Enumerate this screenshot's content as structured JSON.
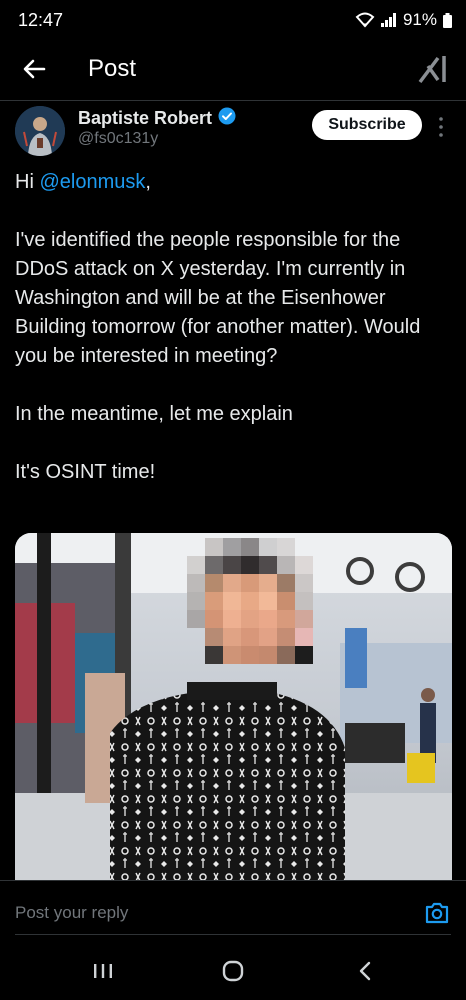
{
  "status_bar": {
    "time": "12:47",
    "battery": "91%"
  },
  "header": {
    "title": "Post",
    "back_icon": "arrow-left-icon",
    "grok_icon": "grok-icon"
  },
  "author": {
    "name": "Baptiste Robert",
    "handle": "@fs0c131y",
    "verified": true,
    "verified_color": "#1d9bf0",
    "subscribe_label": "Subscribe"
  },
  "post": {
    "greeting_prefix": "Hi ",
    "mention": "@elonmusk",
    "greeting_suffix": ",",
    "paragraph_2": "I've identified the people responsible for the DDoS attack on X yesterday. I'm currently in Washington and will be at the Eisenhower Building tomorrow (for another matter). Would you be interested in meeting?",
    "paragraph_3": "In the meantime, let me explain",
    "paragraph_4": "It's OSINT time!"
  },
  "reply": {
    "placeholder": "Post your reply",
    "camera_icon": "camera-icon"
  },
  "colors": {
    "accent": "#1d9bf0",
    "background": "#000000",
    "text": "#e7e9ea",
    "muted": "#71767b"
  }
}
